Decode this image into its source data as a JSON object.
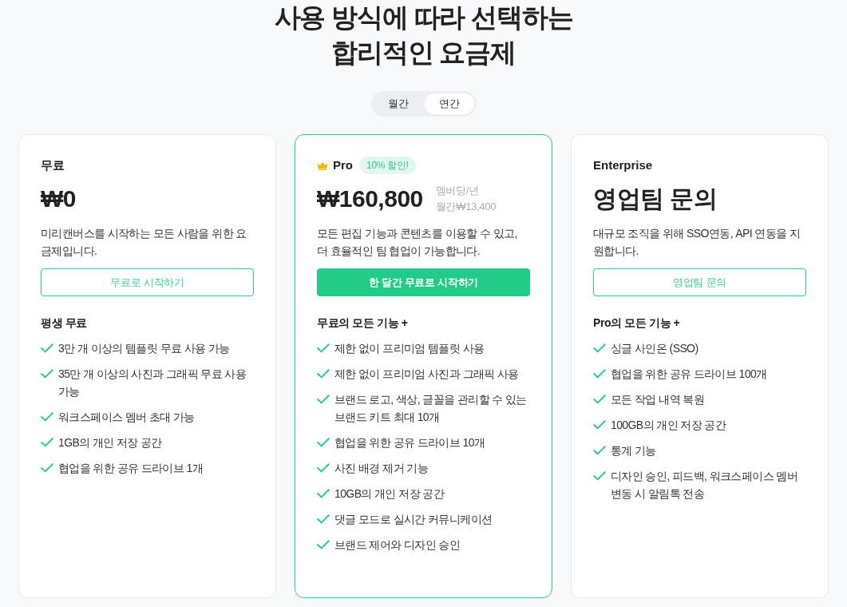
{
  "heading": {
    "lines": [
      "사용 방식에 따라 선택하는",
      "합리적인 요금제"
    ]
  },
  "billing_toggle": [
    {
      "label": "월간",
      "selected": false
    },
    {
      "label": "연간",
      "selected": true
    }
  ],
  "plans": [
    {
      "name": "무료",
      "highlighted": false,
      "price": "₩0",
      "description": "미리캔버스를 시작하는 모든 사람을 위한 요금제입니다.",
      "cta": {
        "label": "무료로 시작하기",
        "kind": "outline"
      },
      "features_title": "평생 무료",
      "features": [
        "3만 개 이상의 템플릿 무료 사용 가능",
        "35만 개 이상의 사진과 그래픽 무료 사용 가능",
        "워크스페이스 멤버 초대 가능",
        "1GB의 개인 저장 공간",
        "협업을 위한 공유 드라이브 1개"
      ]
    },
    {
      "name": "Pro",
      "highlighted": true,
      "badge": "10% 할인!",
      "price": "₩160,800",
      "price_unit": "멤버당/년",
      "price_note": "월간₩13,400",
      "description": "모든 편집 기능과 콘텐츠를 이용할 수 있고, 더 효율적인 팀 협업이 가능합니다.",
      "cta": {
        "label": "한 달간 무료로 시작하기",
        "kind": "filled"
      },
      "features_title": "무료의 모든 기능 +",
      "features": [
        "제한 없이 프리미엄 템플릿 사용",
        "제한 없이 프리미엄 사진과 그래픽 사용",
        "브랜드 로고, 색상, 글꼴을 관리할 수 있는 브랜드 키트 최대 10개",
        "협업을 위한 공유 드라이브 10개",
        "사진 배경 제거 기능",
        "10GB의 개인 저장 공간",
        "댓글 모드로 실시간 커뮤니케이션",
        "브랜드 제어와 디자인 승인"
      ]
    },
    {
      "name": "Enterprise",
      "highlighted": false,
      "price": "영업팀 문의",
      "description": "대규모 조직을 위해 SSO연동, API 연동을 지원합니다.",
      "cta": {
        "label": "영업팀 문의",
        "kind": "outline"
      },
      "features_title": "Pro의 모든 기능 +",
      "features": [
        "싱글 사인온 (SSO)",
        "협업을 위한 공유 드라이브 100개",
        "모든 작업 내역 복원",
        "100GB의 개인 저장 공간",
        "통계 기능",
        "디자인 승인, 피드백, 워크스페이스 멤버 변동 시 알림톡 전송"
      ]
    }
  ]
}
